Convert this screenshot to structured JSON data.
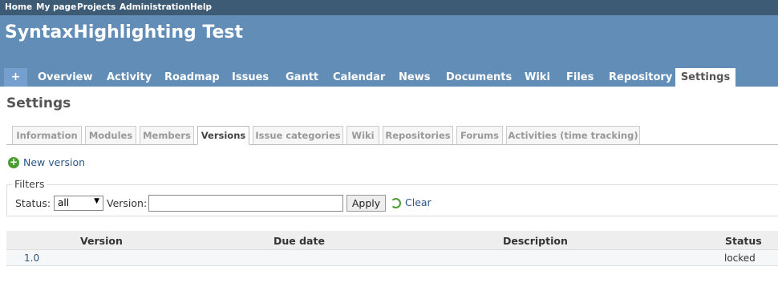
{
  "top_menu": [
    "Home",
    "My page",
    "Projects",
    "Administration",
    "Help"
  ],
  "project_title": "SyntaxHighlighting Test",
  "main_menu": {
    "plus": "+",
    "items": [
      "Overview",
      "Activity",
      "Roadmap",
      "Issues",
      "Gantt",
      "Calendar",
      "News",
      "Documents",
      "Wiki",
      "Files",
      "Repository"
    ],
    "selected": "Settings"
  },
  "page_title": "Settings",
  "settings_tabs": [
    "Information",
    "Modules",
    "Members",
    "Versions",
    "Issue categories",
    "Wiki",
    "Repositories",
    "Forums",
    "Activities (time tracking)"
  ],
  "selected_tab": "Versions",
  "new_version_label": "New version",
  "filters": {
    "legend": "Filters",
    "status_label": "Status:",
    "status_value": "all",
    "version_label": "Version:",
    "version_value": "",
    "apply_label": "Apply",
    "clear_label": "Clear"
  },
  "table": {
    "headers": [
      "Version",
      "Due date",
      "Description",
      "Status"
    ],
    "rows": [
      {
        "version": "1.0",
        "due_date": "",
        "description": "",
        "status": "locked"
      }
    ]
  },
  "colors": {
    "top_bar": "#3e5b76",
    "header": "#628db6",
    "link": "#2a5685",
    "add_icon": "#4d9c31"
  }
}
